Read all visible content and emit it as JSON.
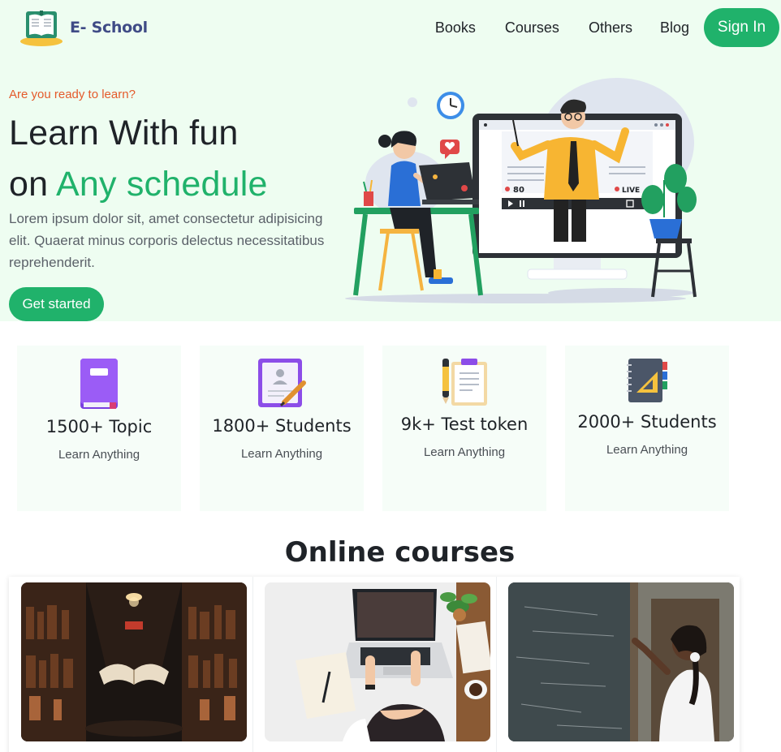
{
  "brand": {
    "name": "E- School",
    "logo_icon": "open-book-logo-icon"
  },
  "nav": {
    "items": [
      "Books",
      "Courses",
      "Others",
      "Blog"
    ],
    "sign_in": "Sign In"
  },
  "hero": {
    "eyebrow": "Are you ready to learn?",
    "headline_line1": "Learn With fun",
    "headline_line2_prefix": "on ",
    "headline_line2_accent": "Any schedule",
    "description": "Lorem ipsum dolor sit, amet consectetur adipisicing elit. Quaerat minus corporis delectus necessitatibus reprehenderit.",
    "cta": "Get started",
    "illustration": {
      "viewer_count": "80",
      "live_badge": "LIVE"
    }
  },
  "stats": [
    {
      "icon": "purple-book-icon",
      "value": "1500+ Topic",
      "caption": "Learn Anything"
    },
    {
      "icon": "certificate-icon",
      "value": "1800+ Students",
      "caption": "Learn Anything"
    },
    {
      "icon": "clipboard-pencil-icon",
      "value": "9k+ Test token",
      "caption": "Learn Anything"
    },
    {
      "icon": "notebook-ruler-icon",
      "value": "2000+ Students",
      "caption": "Learn Anything"
    }
  ],
  "courses": {
    "title": "Online courses",
    "items": [
      {
        "image": "library-floating-book-photo"
      },
      {
        "image": "laptop-desk-photo"
      },
      {
        "image": "girl-chalkboard-photo"
      }
    ]
  },
  "colors": {
    "brand_green": "#20b26b",
    "hero_bg": "#eefdf1",
    "eyebrow": "#e45a2b",
    "brand_text": "#3f4b86"
  }
}
